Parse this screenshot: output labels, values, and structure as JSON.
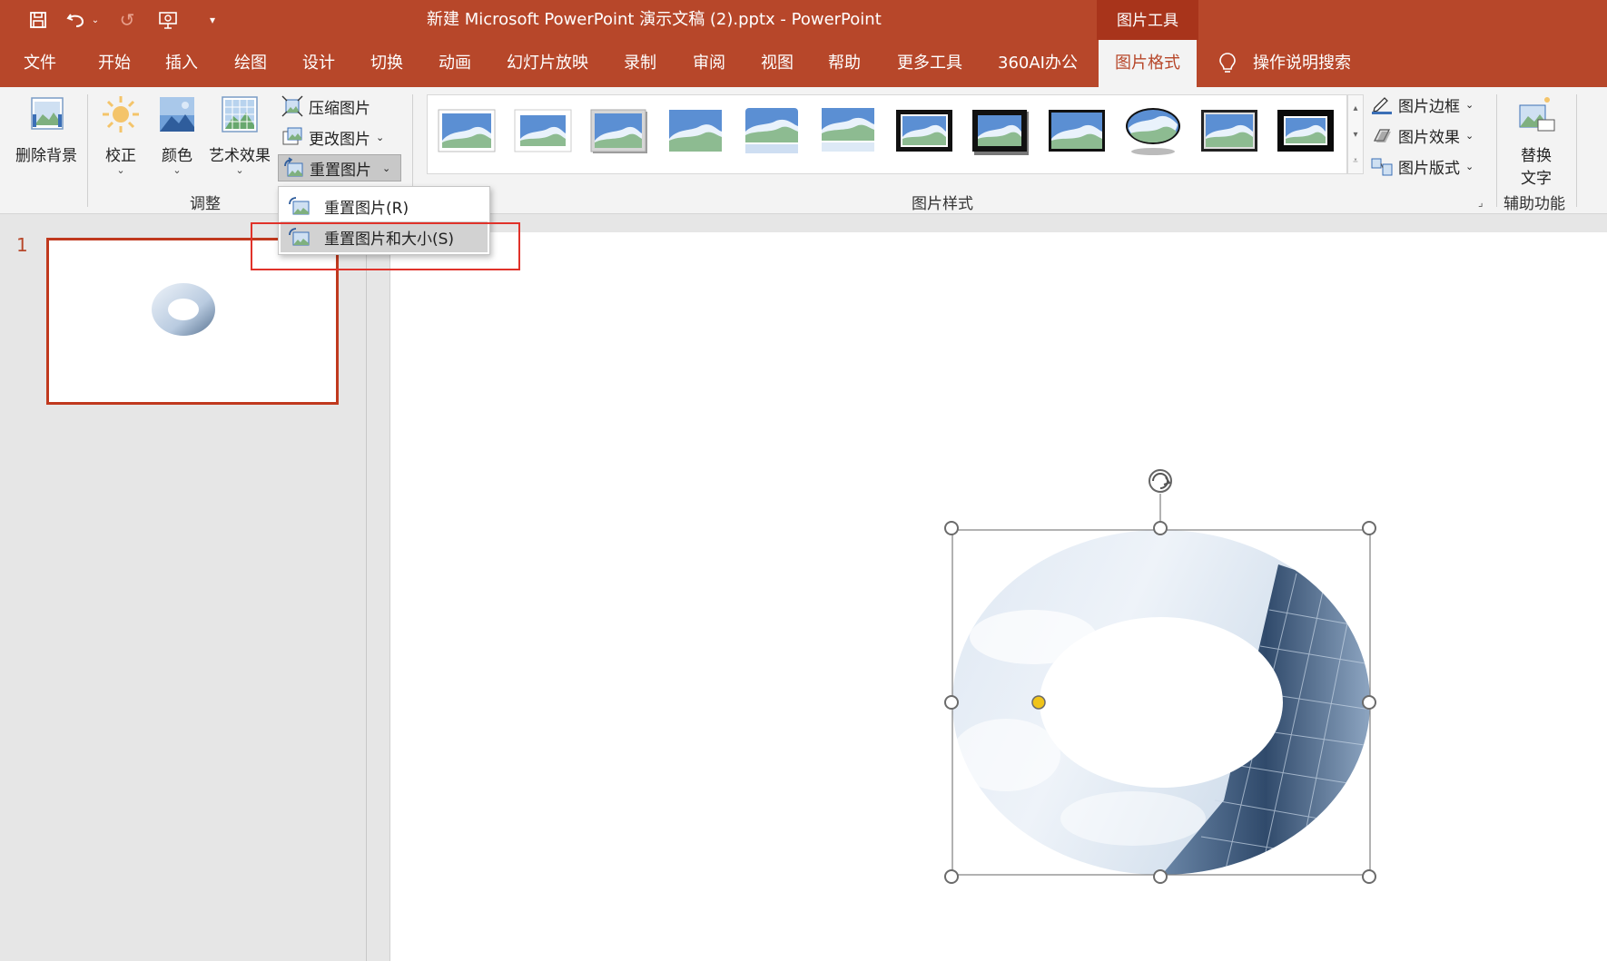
{
  "window": {
    "title": "新建 Microsoft PowerPoint 演示文稿 (2).pptx  -  PowerPoint",
    "context_group": "图片工具"
  },
  "quick_access": [
    "save-icon",
    "undo-icon",
    "redo-icon",
    "present-icon",
    "customize-icon"
  ],
  "tabs": [
    "文件",
    "开始",
    "插入",
    "绘图",
    "设计",
    "切换",
    "动画",
    "幻灯片放映",
    "录制",
    "审阅",
    "视图",
    "帮助",
    "更多工具",
    "360AI办公",
    "图片格式"
  ],
  "active_tab": "图片格式",
  "tell_me": "操作说明搜索",
  "ribbon": {
    "adjust": {
      "remove_bg": "删除背景",
      "corrections": "校正",
      "color": "颜色",
      "artistic": "艺术效果",
      "compress": "压缩图片",
      "change": "更改图片",
      "reset": "重置图片",
      "label": "调整"
    },
    "styles": {
      "label": "图片样式",
      "border": "图片边框",
      "effects": "图片效果",
      "layout": "图片版式"
    },
    "accessibility": {
      "alt_text_line1": "替换",
      "alt_text_line2": "文字",
      "label": "辅助功能"
    }
  },
  "reset_menu": {
    "item1": "重置图片(R)",
    "item2": "重置图片和大小(S)"
  },
  "slides": {
    "number": "1"
  },
  "colors": {
    "accent": "#b7472a",
    "context_tab": "#a8341b",
    "highlight_box": "#e0322a",
    "adjust_handle": "#f0c419"
  }
}
